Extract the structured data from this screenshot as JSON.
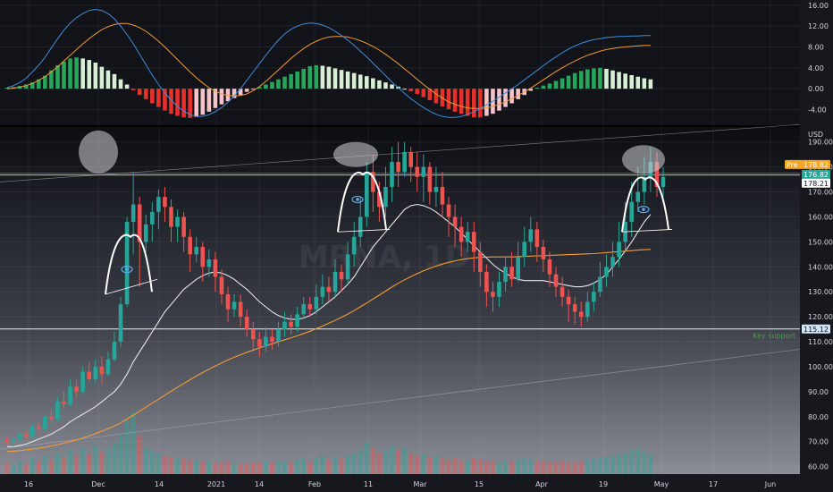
{
  "chart_data": {
    "type": "candlestick",
    "price_axis": {
      "unit": "USD",
      "ticks": [
        190,
        180,
        170,
        160,
        150,
        140,
        130,
        120,
        110,
        100,
        90,
        80,
        70,
        60
      ],
      "ylim": [
        57,
        196
      ]
    },
    "x_axis": {
      "ticks": [
        "16",
        "Dec",
        "14",
        "2021",
        "14",
        "Feb",
        "11",
        "Mar",
        "15",
        "Apr",
        "19",
        "May",
        "17",
        "Jun"
      ]
    },
    "badges": {
      "pre_label": "Pre",
      "pre_value": "178.82",
      "current_value": "176.82",
      "other_value": "178.21",
      "support_value": "115.12"
    },
    "support_line_label": "Key support",
    "watermark": "MRNA, 1D",
    "horizontal_lines": {
      "resistance": 176.8,
      "support": 115.12
    },
    "candles": [
      [
        71,
        70,
        72,
        69
      ],
      [
        70,
        71,
        72,
        68
      ],
      [
        71,
        73,
        74,
        70
      ],
      [
        73,
        72,
        75,
        70
      ],
      [
        72,
        76,
        77,
        71
      ],
      [
        76,
        75,
        78,
        73
      ],
      [
        75,
        80,
        81,
        74
      ],
      [
        80,
        79,
        83,
        77
      ],
      [
        79,
        86,
        88,
        78
      ],
      [
        86,
        85,
        90,
        83
      ],
      [
        85,
        92,
        95,
        84
      ],
      [
        92,
        90,
        95,
        88
      ],
      [
        90,
        98,
        100,
        89
      ],
      [
        98,
        95,
        102,
        94
      ],
      [
        95,
        100,
        103,
        93
      ],
      [
        100,
        97,
        104,
        93
      ],
      [
        97,
        103,
        106,
        96
      ],
      [
        103,
        110,
        114,
        102
      ],
      [
        110,
        125,
        128,
        108
      ],
      [
        125,
        158,
        160,
        124
      ],
      [
        158,
        165,
        178,
        145
      ],
      [
        165,
        150,
        168,
        132
      ],
      [
        150,
        157,
        161,
        146
      ],
      [
        157,
        162,
        166,
        150
      ],
      [
        162,
        168,
        171,
        155
      ],
      [
        168,
        164,
        172,
        158
      ],
      [
        164,
        156,
        167,
        150
      ],
      [
        156,
        160,
        163,
        150
      ],
      [
        160,
        152,
        162,
        146
      ],
      [
        152,
        145,
        155,
        138
      ],
      [
        145,
        148,
        152,
        142
      ],
      [
        148,
        140,
        150,
        134
      ],
      [
        140,
        143,
        147,
        136
      ],
      [
        143,
        136,
        146,
        130
      ],
      [
        136,
        129,
        139,
        125
      ],
      [
        129,
        123,
        132,
        118
      ],
      [
        123,
        126,
        129,
        120
      ],
      [
        126,
        120,
        129,
        116
      ],
      [
        120,
        115,
        123,
        112
      ],
      [
        115,
        111,
        118,
        107
      ],
      [
        111,
        108,
        114,
        104
      ],
      [
        108,
        112,
        116,
        106
      ],
      [
        112,
        110,
        115,
        107
      ],
      [
        110,
        115,
        118,
        108
      ],
      [
        115,
        118,
        122,
        112
      ],
      [
        118,
        116,
        121,
        113
      ],
      [
        116,
        121,
        124,
        114
      ],
      [
        121,
        125,
        128,
        119
      ],
      [
        125,
        123,
        128,
        120
      ],
      [
        123,
        128,
        133,
        121
      ],
      [
        128,
        132,
        137,
        125
      ],
      [
        132,
        130,
        136,
        126
      ],
      [
        130,
        138,
        143,
        128
      ],
      [
        138,
        135,
        141,
        130
      ],
      [
        135,
        145,
        150,
        133
      ],
      [
        145,
        152,
        158,
        140
      ],
      [
        152,
        160,
        168,
        148
      ],
      [
        160,
        178,
        182,
        156
      ],
      [
        178,
        170,
        185,
        162
      ],
      [
        170,
        164,
        174,
        158
      ],
      [
        164,
        172,
        180,
        160
      ],
      [
        172,
        182,
        188,
        166
      ],
      [
        182,
        178,
        190,
        172
      ],
      [
        178,
        186,
        190,
        176
      ],
      [
        186,
        180,
        188,
        174
      ],
      [
        180,
        176,
        186,
        170
      ],
      [
        176,
        180,
        185,
        166
      ],
      [
        180,
        170,
        182,
        165
      ],
      [
        170,
        172,
        180,
        164
      ],
      [
        172,
        165,
        178,
        160
      ],
      [
        165,
        160,
        168,
        152
      ],
      [
        160,
        156,
        165,
        148
      ],
      [
        156,
        150,
        160,
        144
      ],
      [
        150,
        154,
        158,
        146
      ],
      [
        154,
        146,
        158,
        138
      ],
      [
        146,
        138,
        150,
        132
      ],
      [
        138,
        130,
        141,
        124
      ],
      [
        130,
        128,
        134,
        122
      ],
      [
        128,
        134,
        138,
        124
      ],
      [
        134,
        140,
        144,
        130
      ],
      [
        140,
        135,
        146,
        132
      ],
      [
        135,
        144,
        150,
        134
      ],
      [
        144,
        150,
        156,
        140
      ],
      [
        150,
        155,
        160,
        146
      ],
      [
        155,
        148,
        158,
        142
      ],
      [
        148,
        143,
        151,
        138
      ],
      [
        143,
        137,
        146,
        132
      ],
      [
        137,
        132,
        140,
        128
      ],
      [
        132,
        128,
        136,
        124
      ],
      [
        128,
        125,
        131,
        118
      ],
      [
        125,
        122,
        128,
        117
      ],
      [
        122,
        120,
        126,
        116
      ],
      [
        120,
        126,
        130,
        118
      ],
      [
        126,
        130,
        134,
        122
      ],
      [
        130,
        136,
        142,
        128
      ],
      [
        136,
        140,
        145,
        132
      ],
      [
        140,
        144,
        150,
        136
      ],
      [
        144,
        150,
        158,
        140
      ],
      [
        150,
        158,
        166,
        146
      ],
      [
        158,
        166,
        174,
        152
      ],
      [
        166,
        170,
        180,
        162
      ],
      [
        170,
        176,
        184,
        165
      ],
      [
        176,
        182,
        188,
        170
      ],
      [
        182,
        172,
        186,
        168
      ],
      [
        172,
        176,
        180,
        168
      ]
    ],
    "volume": [
      9,
      7,
      10,
      8,
      12,
      10,
      14,
      11,
      16,
      12,
      18,
      14,
      20,
      15,
      22,
      17,
      20,
      24,
      30,
      42,
      48,
      30,
      20,
      18,
      16,
      14,
      13,
      12,
      12,
      11,
      11,
      10,
      10,
      9,
      9,
      10,
      9,
      8,
      8,
      9,
      9,
      10,
      9,
      10,
      10,
      9,
      11,
      12,
      10,
      12,
      14,
      11,
      13,
      12,
      15,
      16,
      18,
      24,
      20,
      16,
      18,
      22,
      18,
      20,
      16,
      14,
      15,
      13,
      14,
      12,
      11,
      12,
      11,
      10,
      12,
      11,
      10,
      10,
      9,
      10,
      10,
      11,
      12,
      11,
      10,
      10,
      9,
      9,
      10,
      9,
      9,
      10,
      11,
      12,
      12,
      13,
      14,
      15,
      16,
      18,
      20,
      17,
      15
    ],
    "macd": {
      "axis_ticks": [
        16,
        12,
        8,
        4,
        0,
        -4
      ],
      "ylim": [
        -7,
        17
      ],
      "histogram": [
        0.2,
        0.3,
        0.5,
        0.8,
        1.2,
        1.8,
        2.5,
        3.5,
        4.5,
        5.2,
        5.8,
        6.0,
        5.8,
        5.5,
        5.0,
        4.2,
        3.5,
        2.8,
        1.8,
        0.8,
        -0.3,
        -1.2,
        -2.0,
        -2.8,
        -3.5,
        -4.2,
        -4.8,
        -5.2,
        -5.5,
        -5.6,
        -5.4,
        -5.0,
        -4.4,
        -3.7,
        -3.0,
        -2.4,
        -1.8,
        -1.2,
        -0.6,
        -0.1,
        0.3,
        0.8,
        1.3,
        1.8,
        2.3,
        2.8,
        3.3,
        3.8,
        4.3,
        4.5,
        4.4,
        4.2,
        3.9,
        3.6,
        3.3,
        3.0,
        2.7,
        2.4,
        2.0,
        1.6,
        1.2,
        0.8,
        0.4,
        0.0,
        -0.5,
        -1.0,
        -1.6,
        -2.2,
        -2.8,
        -3.4,
        -3.9,
        -4.4,
        -4.8,
        -5.2,
        -5.5,
        -5.5,
        -5.2,
        -4.8,
        -4.2,
        -3.5,
        -2.8,
        -2.0,
        -1.2,
        -0.4,
        0.2,
        0.6,
        1.0,
        1.5,
        2.0,
        2.5,
        3.0,
        3.4,
        3.7,
        3.9,
        4.0,
        3.8,
        3.5,
        3.2,
        2.9,
        2.6,
        2.3,
        2.0,
        1.8
      ],
      "macd_line": [
        0.2,
        0.6,
        1.2,
        2.0,
        3.2,
        4.5,
        6.0,
        7.8,
        9.6,
        11.2,
        12.6,
        13.6,
        14.4,
        15.0,
        15.2,
        15.0,
        14.4,
        13.4,
        12.0,
        10.4,
        8.6,
        6.6,
        4.6,
        2.6,
        0.8,
        -0.8,
        -2.2,
        -3.4,
        -4.3,
        -5.0,
        -5.3,
        -5.3,
        -5.0,
        -4.4,
        -3.6,
        -2.6,
        -1.4,
        0.0,
        1.6,
        3.2,
        4.8,
        6.4,
        7.9,
        9.3,
        10.5,
        11.4,
        12.0,
        12.4,
        12.6,
        12.5,
        12.2,
        11.7,
        11.0,
        10.2,
        9.3,
        8.3,
        7.2,
        6.1,
        4.9,
        3.7,
        2.5,
        1.3,
        0.2,
        -0.9,
        -1.9,
        -2.8,
        -3.6,
        -4.3,
        -4.9,
        -5.3,
        -5.5,
        -5.5,
        -5.3,
        -4.9,
        -4.4,
        -3.8,
        -3.1,
        -2.4,
        -1.6,
        -0.8,
        0.0,
        0.8,
        1.7,
        2.6,
        3.5,
        4.4,
        5.3,
        6.1,
        6.9,
        7.6,
        8.2,
        8.7,
        9.1,
        9.4,
        9.6,
        9.8,
        9.9,
        10.0,
        10.0,
        10.1,
        10.1,
        10.2,
        10.2
      ],
      "signal_line": [
        0.0,
        0.1,
        0.3,
        0.6,
        1.0,
        1.6,
        2.3,
        3.2,
        4.2,
        5.3,
        6.4,
        7.5,
        8.6,
        9.6,
        10.5,
        11.3,
        11.9,
        12.3,
        12.5,
        12.5,
        12.2,
        11.7,
        11.0,
        10.1,
        9.1,
        8.0,
        6.8,
        5.6,
        4.4,
        3.2,
        2.1,
        1.1,
        0.2,
        -0.5,
        -1.0,
        -1.3,
        -1.4,
        -1.3,
        -1.0,
        -0.4,
        0.4,
        1.4,
        2.5,
        3.6,
        4.7,
        5.8,
        6.8,
        7.7,
        8.5,
        9.1,
        9.6,
        9.9,
        10.0,
        10.0,
        9.9,
        9.6,
        9.2,
        8.7,
        8.1,
        7.4,
        6.6,
        5.7,
        4.8,
        3.8,
        2.8,
        1.8,
        0.8,
        -0.1,
        -1.0,
        -1.8,
        -2.5,
        -3.0,
        -3.4,
        -3.7,
        -3.8,
        -3.8,
        -3.7,
        -3.4,
        -3.0,
        -2.5,
        -1.9,
        -1.3,
        -0.6,
        0.1,
        0.9,
        1.7,
        2.5,
        3.3,
        4.0,
        4.7,
        5.3,
        5.9,
        6.4,
        6.8,
        7.2,
        7.5,
        7.7,
        7.9,
        8.0,
        8.1,
        8.2,
        8.3,
        8.3
      ]
    },
    "moving_average_fast": [
      68,
      68,
      68.5,
      69,
      70,
      71,
      72,
      73,
      74.5,
      76,
      78,
      79.5,
      81,
      82.5,
      84,
      86,
      88,
      90,
      93,
      97,
      102,
      106,
      110,
      114,
      118,
      122,
      125,
      128,
      131,
      133,
      135,
      136.5,
      137.5,
      138,
      137.5,
      136.5,
      135,
      133,
      131,
      128.5,
      126,
      124,
      122,
      120.5,
      119.5,
      119,
      119,
      119.5,
      120.5,
      122,
      124,
      126,
      128,
      130.5,
      133,
      136,
      140,
      144,
      148,
      151,
      154,
      157,
      160,
      163,
      164.5,
      165,
      164.5,
      163.5,
      162,
      160,
      158,
      156,
      153.5,
      151,
      148.5,
      146,
      143.5,
      141,
      139,
      137.5,
      136,
      135,
      134.5,
      134.5,
      134.5,
      134.5,
      134,
      133.5,
      133,
      132.5,
      132,
      132,
      132.5,
      133.5,
      135,
      137,
      140,
      143,
      146.5,
      150,
      154,
      158,
      161
    ],
    "moving_average_slow": [
      66,
      66.2,
      66.4,
      66.7,
      67,
      67.4,
      67.8,
      68.3,
      68.8,
      69.4,
      70,
      70.7,
      71.5,
      72.3,
      73.2,
      74.2,
      75.2,
      76.3,
      77.5,
      79,
      80.6,
      82.2,
      83.8,
      85.4,
      87,
      88.6,
      90.2,
      91.8,
      93.3,
      94.8,
      96.3,
      97.7,
      99,
      100.3,
      101.5,
      102.7,
      103.8,
      104.8,
      105.8,
      106.7,
      107.6,
      108.4,
      109.2,
      110,
      110.8,
      111.6,
      112.4,
      113.3,
      114.2,
      115.2,
      116.3,
      117.4,
      118.6,
      119.8,
      121.1,
      122.5,
      124,
      125.5,
      127.1,
      128.7,
      130.3,
      131.9,
      133.4,
      134.8,
      136.1,
      137.3,
      138.4,
      139.4,
      140.3,
      141.1,
      141.8,
      142.4,
      142.9,
      143.3,
      143.6,
      143.8,
      143.9,
      144,
      144,
      144,
      144,
      144.1,
      144.2,
      144.3,
      144.4,
      144.5,
      144.6,
      144.7,
      144.8,
      144.9,
      145,
      145.1,
      145.2,
      145.3,
      145.5,
      145.7,
      145.9,
      146.1,
      146.3,
      146.5,
      146.7,
      146.9,
      147
    ]
  }
}
